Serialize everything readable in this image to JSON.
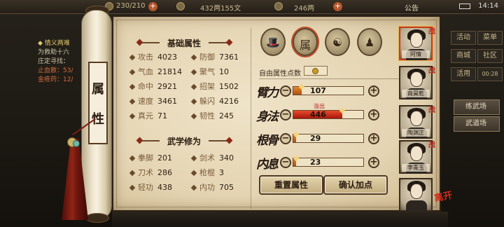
{
  "topbar": {
    "res1": "230/210",
    "res2": "432两155文",
    "res3": "246两",
    "notice": "公告",
    "time": "14:14"
  },
  "quest": {
    "title": "◆ 情义两难",
    "line1": "为救助十六",
    "line2": "庄定寻找：",
    "line3": "止血散：53/",
    "line4": "金疮药：12/"
  },
  "right_menu": {
    "b1": "活动",
    "b2": "菜单",
    "b3": "商城",
    "b4": "社区",
    "b5": "活用",
    "b6": "00:28",
    "side1": "练武场",
    "side2": "武道场"
  },
  "scroll_tab": [
    "属",
    "性"
  ],
  "basic": {
    "title": "基础属性",
    "stats": [
      {
        "label": "攻击",
        "value": "4023"
      },
      {
        "label": "防御",
        "value": "7361"
      },
      {
        "label": "气血",
        "value": "21814"
      },
      {
        "label": "聚气",
        "value": "10"
      },
      {
        "label": "命中",
        "value": "2921"
      },
      {
        "label": "招架",
        "value": "1502"
      },
      {
        "label": "速度",
        "value": "3461"
      },
      {
        "label": "躲闪",
        "value": "4216"
      },
      {
        "label": "真元",
        "value": "71"
      },
      {
        "label": "韧性",
        "value": "245"
      }
    ]
  },
  "martial": {
    "title": "武学修为",
    "stats": [
      {
        "label": "拳脚",
        "value": "201"
      },
      {
        "label": "剑术",
        "value": "340"
      },
      {
        "label": "刀术",
        "value": "286"
      },
      {
        "label": "枪棍",
        "value": "3"
      },
      {
        "label": "轻功",
        "value": "438"
      },
      {
        "label": "内功",
        "value": "705"
      }
    ]
  },
  "top_icons": [
    {
      "icon": "hat-icon",
      "glyph": "🎩"
    },
    {
      "icon": "attribute-book-icon",
      "glyph": "属"
    },
    {
      "icon": "taiji-icon",
      "glyph": "☯"
    },
    {
      "icon": "meridian-figure-icon",
      "glyph": "♟"
    }
  ],
  "free_points": {
    "label": "自由属性点数",
    "value": ""
  },
  "attributes": [
    {
      "name": "臂力",
      "value": "107",
      "fill": 0.12,
      "color": "#c05a18"
    },
    {
      "name": "身法",
      "value": "446",
      "fill": 0.7,
      "color": "#c4220f",
      "note": "溢出"
    },
    {
      "name": "根骨",
      "value": "29",
      "fill": 0.03,
      "color": "#c05a18"
    },
    {
      "name": "内息",
      "value": "23",
      "fill": 0.03,
      "color": "#c05a18"
    }
  ],
  "buttons": {
    "reset": "重置属性",
    "confirm": "确认加点"
  },
  "party": [
    {
      "name": "阿情",
      "badge": "战"
    },
    {
      "name": "商昊乾",
      "badge": "战"
    },
    {
      "name": "陶渊正",
      "badge": "战"
    },
    {
      "name": "李青玉",
      "badge": "战"
    },
    {
      "name": "",
      "badge": ""
    }
  ],
  "leave_label": "离开"
}
